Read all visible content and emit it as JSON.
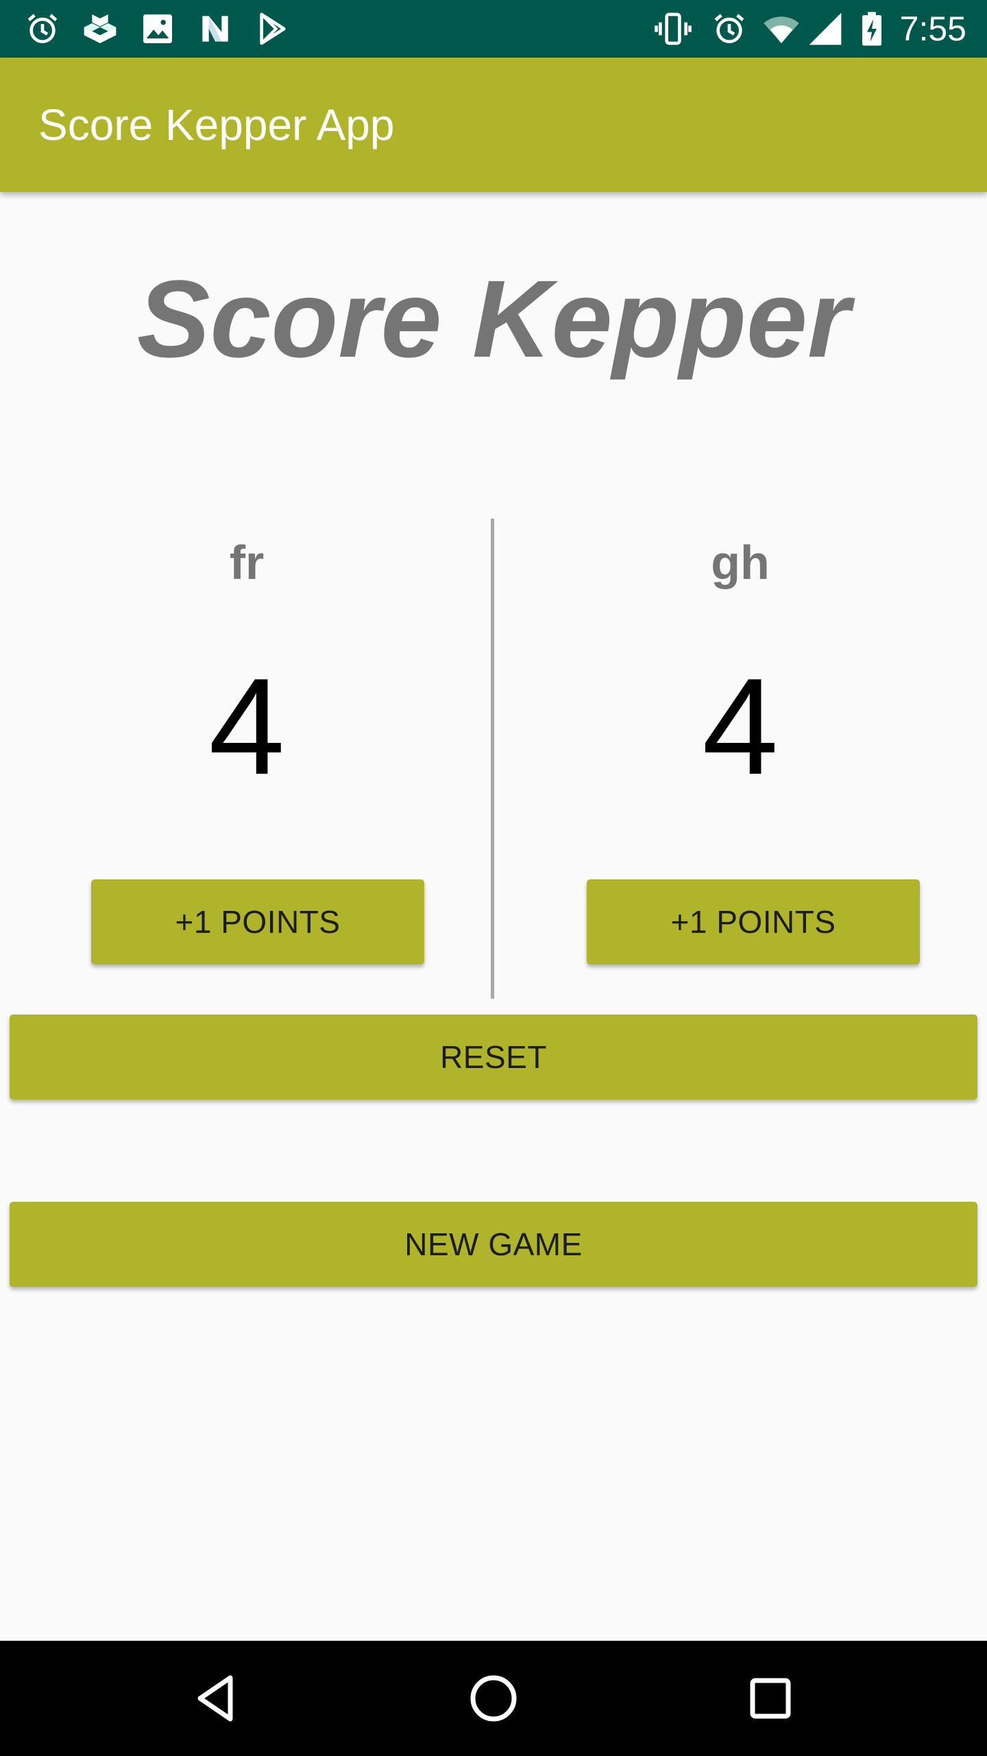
{
  "status_bar": {
    "time": "7:55",
    "left_icons": [
      "alarm-icon",
      "cluster-app-icon",
      "image-icon",
      "n-app-icon",
      "play-store-icon"
    ],
    "right_icons": [
      "vibrate-icon",
      "alarm-icon",
      "wifi-icon",
      "cell-signal-icon",
      "battery-charging-icon"
    ]
  },
  "app_bar": {
    "title": "Score Kepper App",
    "color": "#afb42b"
  },
  "heading": "Score Kepper",
  "teams": [
    {
      "name": "fr",
      "score": "4",
      "button_label": "+1 POINTS"
    },
    {
      "name": "gh",
      "score": "4",
      "button_label": "+1 POINTS"
    }
  ],
  "actions": {
    "reset_label": "RESET",
    "new_game_label": "NEW GAME"
  },
  "nav_bar": {
    "icons": [
      "back-icon",
      "home-icon",
      "recents-icon"
    ]
  },
  "colors": {
    "status_bar": "#00574b",
    "accent": "#afb42b",
    "background": "#fafafa",
    "heading_text": "#757575"
  }
}
